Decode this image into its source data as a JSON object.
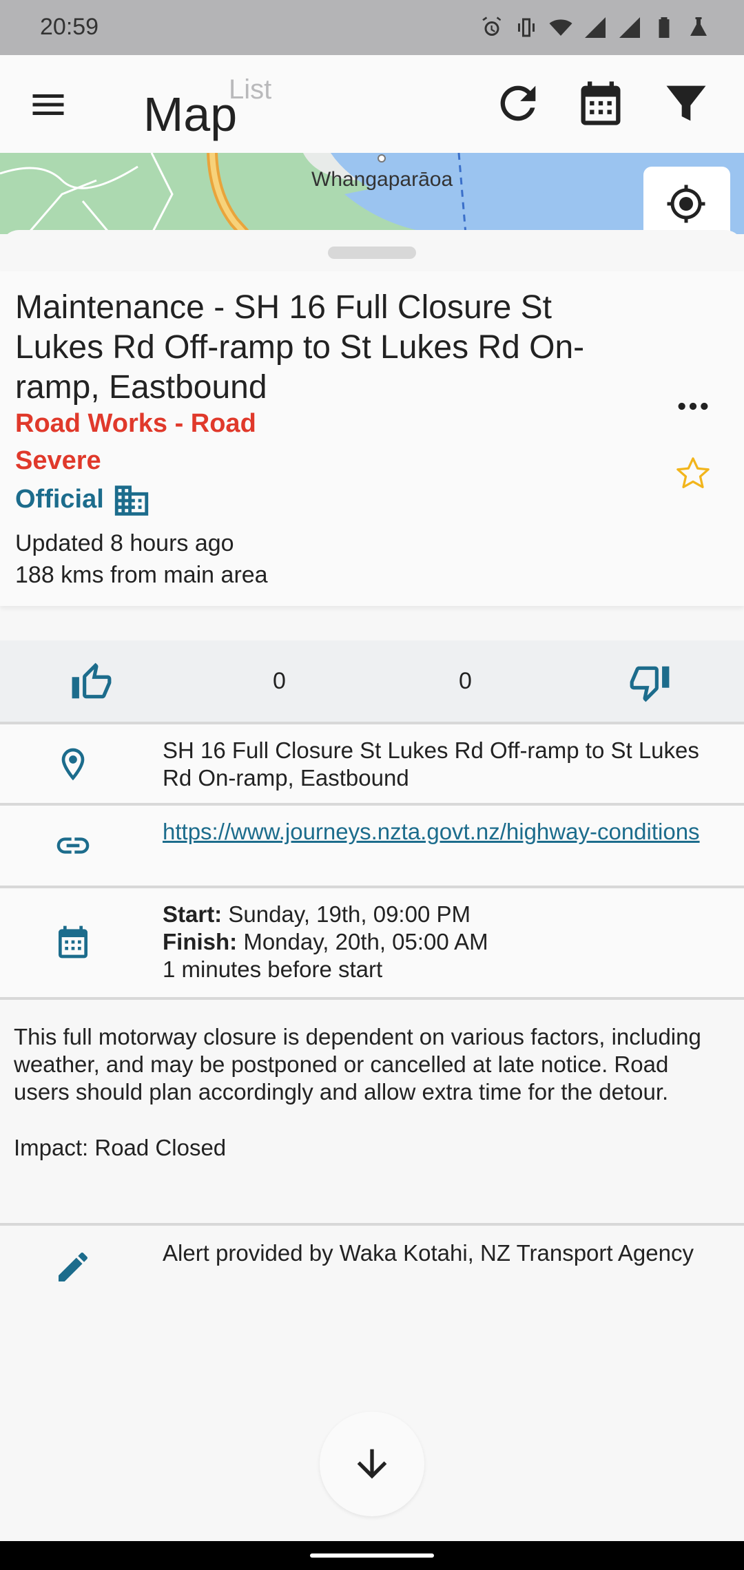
{
  "status_bar": {
    "time": "20:59",
    "icons": [
      "alarm-icon",
      "vibrate-icon",
      "wifi-icon",
      "signal-icon",
      "signal-icon",
      "battery-icon",
      "lab-icon"
    ]
  },
  "app_bar": {
    "title": "Map",
    "secondary_title": "List",
    "icons": [
      "menu-icon",
      "refresh-icon",
      "calendar-icon",
      "filter-icon"
    ]
  },
  "map": {
    "label": "Whangaparāoa",
    "locate_icon": "my-location-icon"
  },
  "event": {
    "title": "Maintenance - SH 16 Full Closure St Lukes Rd Off-ramp to St Lukes Rd On-ramp, Eastbound",
    "category": "Road Works - Road",
    "severity": "Severe",
    "official": "Official",
    "updated": "Updated 8 hours ago",
    "distance": "188 kms from main area"
  },
  "votes": {
    "up": "0",
    "down": "0"
  },
  "location": {
    "text": "SH 16 Full Closure St Lukes Rd Off-ramp to St Lukes Rd On-ramp, Eastbound"
  },
  "link": {
    "text": "https://www.journeys.nzta.govt.nz/highway-conditions"
  },
  "schedule": {
    "start_label": "Start:",
    "start_value": " Sunday, 19th, 09:00 PM",
    "finish_label": "Finish:",
    "finish_value": " Monday, 20th, 05:00 AM",
    "relative": "1 minutes before start"
  },
  "description": {
    "text": "This full motorway closure is dependent on various factors, including weather, and may be postponed or cancelled at late notice. Road users should plan accordingly and allow extra time for the detour.",
    "impact": "Impact: Road Closed"
  },
  "provider": {
    "text": "Alert provided by Waka Kotahi, NZ Transport Agency"
  },
  "colors": {
    "accent": "#1c6c8c",
    "severity": "#e0392b",
    "star": "#f2b51c"
  }
}
